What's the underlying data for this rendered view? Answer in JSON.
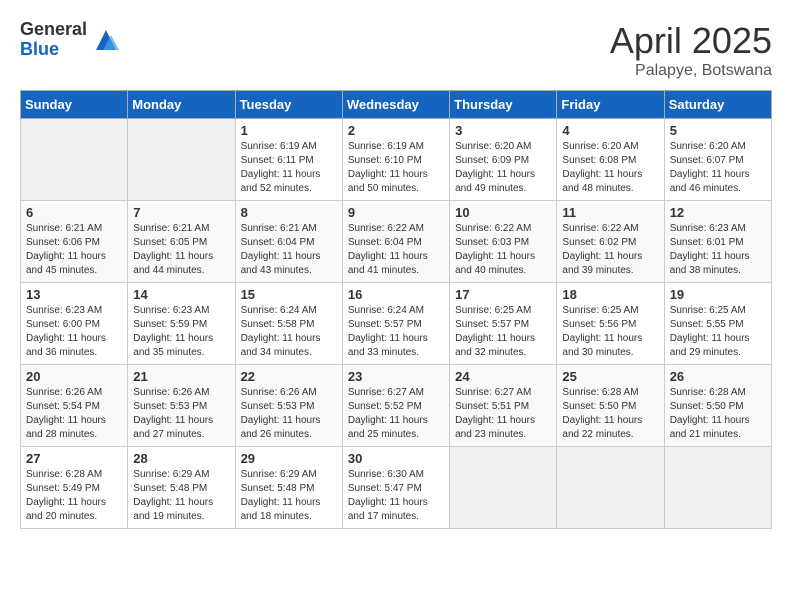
{
  "header": {
    "logo_general": "General",
    "logo_blue": "Blue",
    "month": "April 2025",
    "location": "Palapye, Botswana"
  },
  "days_of_week": [
    "Sunday",
    "Monday",
    "Tuesday",
    "Wednesday",
    "Thursday",
    "Friday",
    "Saturday"
  ],
  "weeks": [
    [
      {
        "day": "",
        "info": ""
      },
      {
        "day": "",
        "info": ""
      },
      {
        "day": "1",
        "info": "Sunrise: 6:19 AM\nSunset: 6:11 PM\nDaylight: 11 hours and 52 minutes."
      },
      {
        "day": "2",
        "info": "Sunrise: 6:19 AM\nSunset: 6:10 PM\nDaylight: 11 hours and 50 minutes."
      },
      {
        "day": "3",
        "info": "Sunrise: 6:20 AM\nSunset: 6:09 PM\nDaylight: 11 hours and 49 minutes."
      },
      {
        "day": "4",
        "info": "Sunrise: 6:20 AM\nSunset: 6:08 PM\nDaylight: 11 hours and 48 minutes."
      },
      {
        "day": "5",
        "info": "Sunrise: 6:20 AM\nSunset: 6:07 PM\nDaylight: 11 hours and 46 minutes."
      }
    ],
    [
      {
        "day": "6",
        "info": "Sunrise: 6:21 AM\nSunset: 6:06 PM\nDaylight: 11 hours and 45 minutes."
      },
      {
        "day": "7",
        "info": "Sunrise: 6:21 AM\nSunset: 6:05 PM\nDaylight: 11 hours and 44 minutes."
      },
      {
        "day": "8",
        "info": "Sunrise: 6:21 AM\nSunset: 6:04 PM\nDaylight: 11 hours and 43 minutes."
      },
      {
        "day": "9",
        "info": "Sunrise: 6:22 AM\nSunset: 6:04 PM\nDaylight: 11 hours and 41 minutes."
      },
      {
        "day": "10",
        "info": "Sunrise: 6:22 AM\nSunset: 6:03 PM\nDaylight: 11 hours and 40 minutes."
      },
      {
        "day": "11",
        "info": "Sunrise: 6:22 AM\nSunset: 6:02 PM\nDaylight: 11 hours and 39 minutes."
      },
      {
        "day": "12",
        "info": "Sunrise: 6:23 AM\nSunset: 6:01 PM\nDaylight: 11 hours and 38 minutes."
      }
    ],
    [
      {
        "day": "13",
        "info": "Sunrise: 6:23 AM\nSunset: 6:00 PM\nDaylight: 11 hours and 36 minutes."
      },
      {
        "day": "14",
        "info": "Sunrise: 6:23 AM\nSunset: 5:59 PM\nDaylight: 11 hours and 35 minutes."
      },
      {
        "day": "15",
        "info": "Sunrise: 6:24 AM\nSunset: 5:58 PM\nDaylight: 11 hours and 34 minutes."
      },
      {
        "day": "16",
        "info": "Sunrise: 6:24 AM\nSunset: 5:57 PM\nDaylight: 11 hours and 33 minutes."
      },
      {
        "day": "17",
        "info": "Sunrise: 6:25 AM\nSunset: 5:57 PM\nDaylight: 11 hours and 32 minutes."
      },
      {
        "day": "18",
        "info": "Sunrise: 6:25 AM\nSunset: 5:56 PM\nDaylight: 11 hours and 30 minutes."
      },
      {
        "day": "19",
        "info": "Sunrise: 6:25 AM\nSunset: 5:55 PM\nDaylight: 11 hours and 29 minutes."
      }
    ],
    [
      {
        "day": "20",
        "info": "Sunrise: 6:26 AM\nSunset: 5:54 PM\nDaylight: 11 hours and 28 minutes."
      },
      {
        "day": "21",
        "info": "Sunrise: 6:26 AM\nSunset: 5:53 PM\nDaylight: 11 hours and 27 minutes."
      },
      {
        "day": "22",
        "info": "Sunrise: 6:26 AM\nSunset: 5:53 PM\nDaylight: 11 hours and 26 minutes."
      },
      {
        "day": "23",
        "info": "Sunrise: 6:27 AM\nSunset: 5:52 PM\nDaylight: 11 hours and 25 minutes."
      },
      {
        "day": "24",
        "info": "Sunrise: 6:27 AM\nSunset: 5:51 PM\nDaylight: 11 hours and 23 minutes."
      },
      {
        "day": "25",
        "info": "Sunrise: 6:28 AM\nSunset: 5:50 PM\nDaylight: 11 hours and 22 minutes."
      },
      {
        "day": "26",
        "info": "Sunrise: 6:28 AM\nSunset: 5:50 PM\nDaylight: 11 hours and 21 minutes."
      }
    ],
    [
      {
        "day": "27",
        "info": "Sunrise: 6:28 AM\nSunset: 5:49 PM\nDaylight: 11 hours and 20 minutes."
      },
      {
        "day": "28",
        "info": "Sunrise: 6:29 AM\nSunset: 5:48 PM\nDaylight: 11 hours and 19 minutes."
      },
      {
        "day": "29",
        "info": "Sunrise: 6:29 AM\nSunset: 5:48 PM\nDaylight: 11 hours and 18 minutes."
      },
      {
        "day": "30",
        "info": "Sunrise: 6:30 AM\nSunset: 5:47 PM\nDaylight: 11 hours and 17 minutes."
      },
      {
        "day": "",
        "info": ""
      },
      {
        "day": "",
        "info": ""
      },
      {
        "day": "",
        "info": ""
      }
    ]
  ]
}
